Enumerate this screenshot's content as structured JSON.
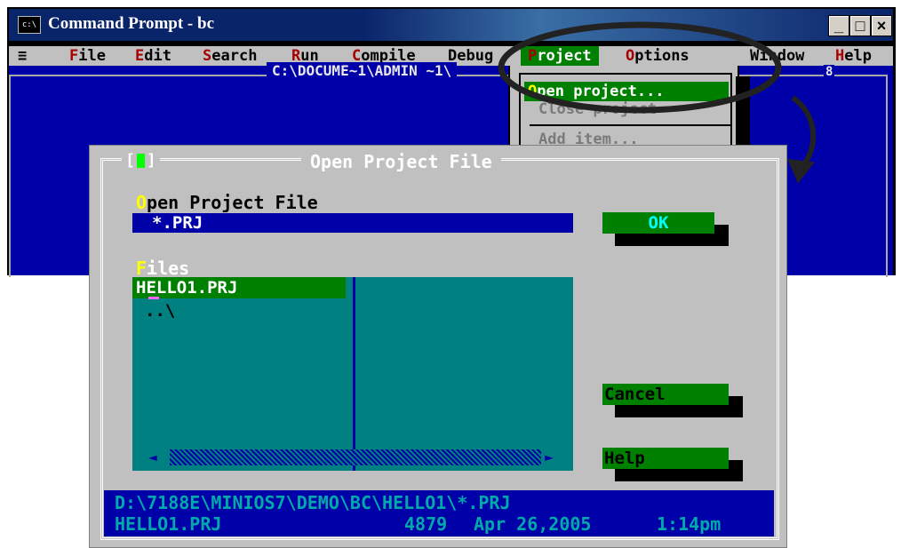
{
  "window": {
    "title": "Command Prompt - bc",
    "icon_text": "c:\\",
    "minimize": "_",
    "maximize": "□",
    "close": "×"
  },
  "menubar": {
    "system": "≡",
    "items": [
      {
        "hot": "F",
        "rest": "ile"
      },
      {
        "hot": "E",
        "rest": "dit"
      },
      {
        "hot": "S",
        "rest": "earch"
      },
      {
        "hot": "R",
        "rest": "un"
      },
      {
        "hot": "C",
        "rest": "ompile"
      },
      {
        "hot": "",
        "rest": "Debug"
      },
      {
        "hot": "P",
        "rest": "roject"
      },
      {
        "hot": "O",
        "rest": "ptions"
      },
      {
        "hot": "",
        "rest": "Window"
      },
      {
        "hot": "H",
        "rest": "elp"
      }
    ]
  },
  "desktop": {
    "editor_path": "C:\\DOCUME~1\\ADMIN ~1\\",
    "window_number": "8"
  },
  "project_menu": {
    "open_hot": "O",
    "open_rest": "pen project...",
    "close": "Close project",
    "add": "Add item..."
  },
  "dialog": {
    "title": "Open Project File",
    "open_label_hot": "O",
    "open_label_rest": "pen Project File",
    "name_value": "*.PRJ",
    "files_label_hot": "F",
    "files_label_rest": "iles",
    "files": [
      "HELLO1.PRJ",
      "..\\"
    ],
    "ok": "OK",
    "cancel": "Cancel",
    "help": "Help",
    "scroll_left": "◄",
    "scroll_right": "►"
  },
  "info": {
    "path": "D:\\7188E\\MINIOS7\\DEMO\\BC\\HELLO1\\*.PRJ",
    "file": "HELLO1.PRJ",
    "size": "4879",
    "date": "Apr 26,2005",
    "time": "1:14pm"
  },
  "colors": {
    "desktop_blue": "#0000a8",
    "menu_gray": "#c0c0c0",
    "highlight_green": "#008000",
    "list_teal": "#008080",
    "hotkey_red": "#a80000",
    "hotkey_yellow": "#ffff00"
  }
}
